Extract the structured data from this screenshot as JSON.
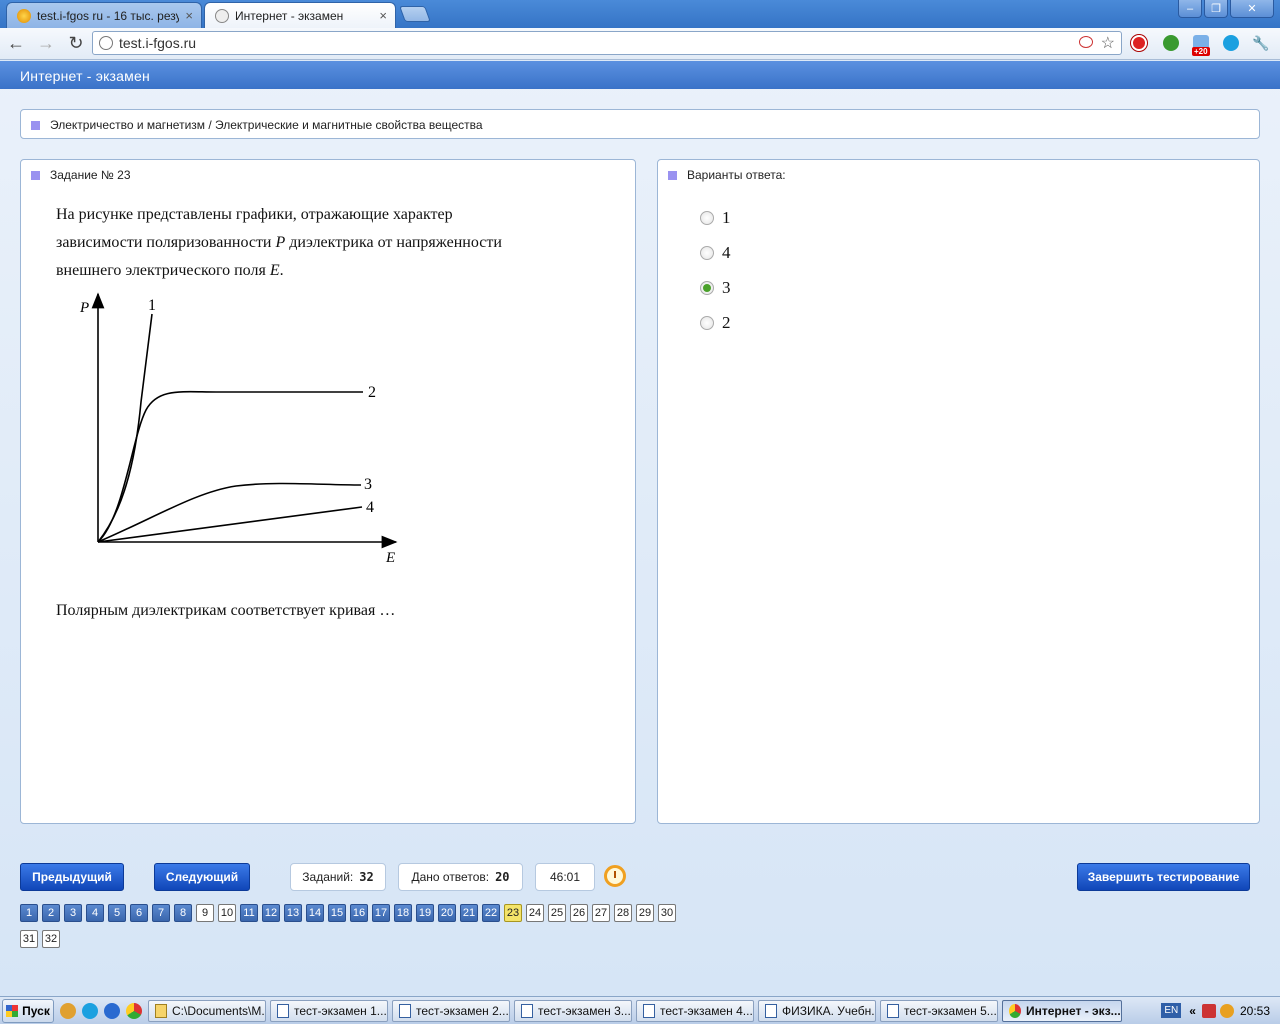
{
  "browser": {
    "tabs": [
      {
        "label": "test.i-fgos ru - 16 тыс. резуль",
        "close": "×"
      },
      {
        "label": "Интернет - экзамен",
        "close": "×"
      }
    ],
    "url": "test.i-fgos.ru",
    "extension_badge": "+20",
    "window_buttons": {
      "minimize": "–",
      "restore": "❐",
      "close": "✕"
    }
  },
  "app": {
    "title": "Интернет - экзамен",
    "breadcrumb": "Электричество и магнетизм / Электрические и магнитные свойства вещества"
  },
  "question": {
    "header": "Задание № 23",
    "text_line1": "На рисунке представлены графики, отражающие характер",
    "text_line2_pre": "зависимости поляризованности ",
    "text_line2_var": "P",
    "text_line2_post": " диэлектрика от напряженности",
    "text_line3_pre": "внешнего электрического поля ",
    "text_line3_var": "E",
    "text_line3_post": ".",
    "prompt": "Полярным диэлектрикам соответствует кривая …",
    "graph": {
      "y_axis_label": "P",
      "x_axis_label": "E",
      "curve_labels": [
        "1",
        "2",
        "3",
        "4"
      ]
    }
  },
  "answers": {
    "header": "Варианты ответа:",
    "options": [
      {
        "label": "1",
        "checked": false
      },
      {
        "label": "4",
        "checked": false
      },
      {
        "label": "3",
        "checked": true
      },
      {
        "label": "2",
        "checked": false
      }
    ]
  },
  "controls": {
    "prev_label": "Предыдущий",
    "next_label": "Следующий",
    "tasks_label": "Заданий:",
    "tasks_value": "32",
    "answers_label": "Дано ответов:",
    "answers_value": "20",
    "timer": "46:01",
    "finish_label": "Завершить тестирование"
  },
  "question_nav": {
    "numbers": [
      "1",
      "2",
      "3",
      "4",
      "5",
      "6",
      "7",
      "8",
      "9",
      "10",
      "11",
      "12",
      "13",
      "14",
      "15",
      "16",
      "17",
      "18",
      "19",
      "20",
      "21",
      "22",
      "23",
      "24",
      "25",
      "26",
      "27",
      "28",
      "29",
      "30",
      "31",
      "32"
    ],
    "answered": [
      "1",
      "2",
      "3",
      "4",
      "5",
      "6",
      "7",
      "8",
      "11",
      "12",
      "13",
      "14",
      "15",
      "16",
      "17",
      "18",
      "19",
      "20",
      "21",
      "22"
    ],
    "current": "23"
  },
  "taskbar": {
    "start_label": "Пуск",
    "tasks": [
      "C:\\Documents\\M...",
      "тест-экзамен 1....",
      "тест-экзамен 2....",
      "тест-экзамен 3....",
      "тест-экзамен 4....",
      "ФИЗИКА. Учебн...",
      "тест-экзамен 5....",
      "Интернет - экз..."
    ],
    "language": "EN",
    "tray_chevron": "«",
    "clock": "20:53"
  }
}
